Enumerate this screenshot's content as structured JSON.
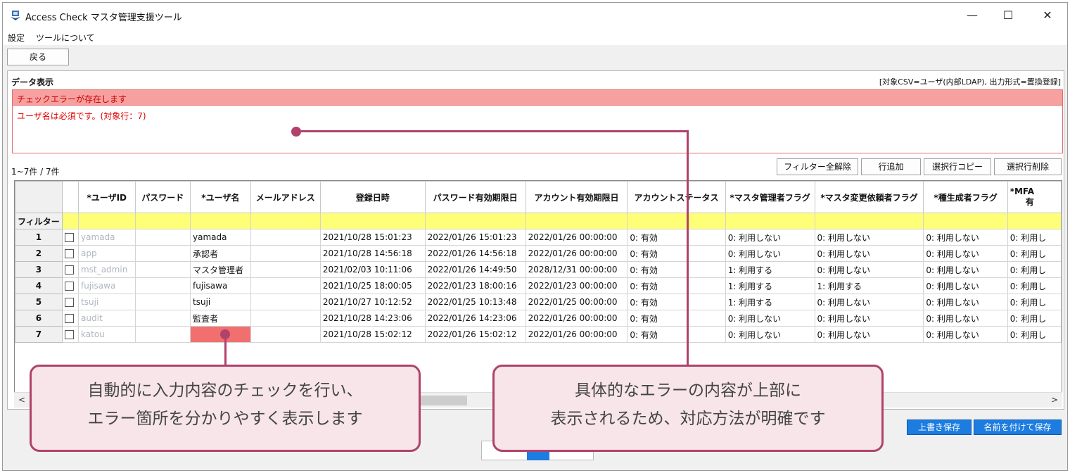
{
  "window": {
    "title": "Access Check マスタ管理支援ツール",
    "minimize": "—",
    "maximize": "☐",
    "close": "✕"
  },
  "menu": [
    "設定",
    "ツールについて"
  ],
  "toolbar": {
    "back_label": "戻る"
  },
  "panel": {
    "title": "データ表示",
    "target_info": "[対象CSV=ユーザ(内部LDAP), 出力形式=置換登録]"
  },
  "errors": {
    "header": "チェックエラーが存在します",
    "message": "ユーザ名は必須です。(対象行：7)"
  },
  "record_count": "1~7件 / 7件",
  "actions": {
    "clear_filter": "フィルター全解除",
    "add_row": "行追加",
    "copy_row": "選択行コピー",
    "delete_row": "選択行削除"
  },
  "table": {
    "columns": [
      "*ユーザID",
      "パスワード",
      "*ユーザ名",
      "メールアドレス",
      "登録日時",
      "パスワード有効期限日",
      "アカウント有効期限日",
      "アカウントステータス",
      "*マスタ管理者フラグ",
      "*マスタ変更依頼者フラグ",
      "*種生成者フラグ",
      "*MFA"
    ],
    "last_column_sub": "有",
    "filter_label": "フィルター",
    "rows": [
      {
        "num": "1",
        "cells": [
          "yamada",
          "",
          "yamada",
          "",
          "2021/10/28 15:01:23",
          "2022/01/26 15:01:23",
          "2022/01/26 00:00:00",
          "0: 有効",
          "0: 利用しない",
          "0: 利用しない",
          "0: 利用しない",
          "0: 利用し"
        ]
      },
      {
        "num": "2",
        "cells": [
          "app",
          "",
          "承認者",
          "",
          "2021/10/28 14:56:18",
          "2022/01/26 14:56:18",
          "2022/01/26 00:00:00",
          "0: 有効",
          "0: 利用しない",
          "0: 利用しない",
          "0: 利用しない",
          "0: 利用し"
        ]
      },
      {
        "num": "3",
        "cells": [
          "mst_admin",
          "",
          "マスタ管理者",
          "",
          "2021/02/03 10:11:06",
          "2022/01/26 14:49:50",
          "2028/12/31 00:00:00",
          "0: 有効",
          "1: 利用する",
          "0: 利用しない",
          "0: 利用しない",
          "0: 利用し"
        ]
      },
      {
        "num": "4",
        "cells": [
          "fujisawa",
          "",
          "fujisawa",
          "",
          "2021/10/25 18:00:05",
          "2022/01/23 18:00:16",
          "2022/01/23 00:00:00",
          "0: 有効",
          "1: 利用する",
          "1: 利用する",
          "0: 利用しない",
          "0: 利用し"
        ]
      },
      {
        "num": "5",
        "cells": [
          "tsuji",
          "",
          "tsuji",
          "",
          "2021/10/27 10:12:52",
          "2022/01/25 10:13:48",
          "2022/01/25 00:00:00",
          "0: 有効",
          "1: 利用する",
          "0: 利用しない",
          "0: 利用しない",
          "0: 利用し"
        ]
      },
      {
        "num": "6",
        "cells": [
          "audit",
          "",
          "監査者",
          "",
          "2021/10/28 14:23:06",
          "2022/01/26 14:23:06",
          "2022/01/26 00:00:00",
          "0: 有効",
          "0: 利用しない",
          "0: 利用しない",
          "0: 利用しない",
          "0: 利用し"
        ]
      },
      {
        "num": "7",
        "cells": [
          "katou",
          "",
          "",
          "",
          "2021/10/28 15:02:12",
          "2022/01/26 15:02:12",
          "2022/01/26 00:00:00",
          "0: 有効",
          "0: 利用しない",
          "0: 利用しない",
          "0: 利用しない",
          "0: 利用し"
        ]
      }
    ]
  },
  "scroll": {
    "left": "<",
    "right": ">"
  },
  "save": {
    "overwrite": "上書き保存",
    "save_as": "名前を付けて保存"
  },
  "callouts": {
    "left_line1": "自動的に入力内容のチェックを行い、",
    "left_line2": "エラー箇所を分かりやすく表示します",
    "right_line1": "具体的なエラーの内容が上部に",
    "right_line2": "表示されるため、対応方法が明確です"
  },
  "colors": {
    "error_bg": "#f6a0a0",
    "error_text": "#e00000",
    "filter_bg": "#ffff77",
    "accent": "#1c7ce0",
    "callout_border": "#b0426b",
    "callout_bg": "#f7e5ea"
  }
}
